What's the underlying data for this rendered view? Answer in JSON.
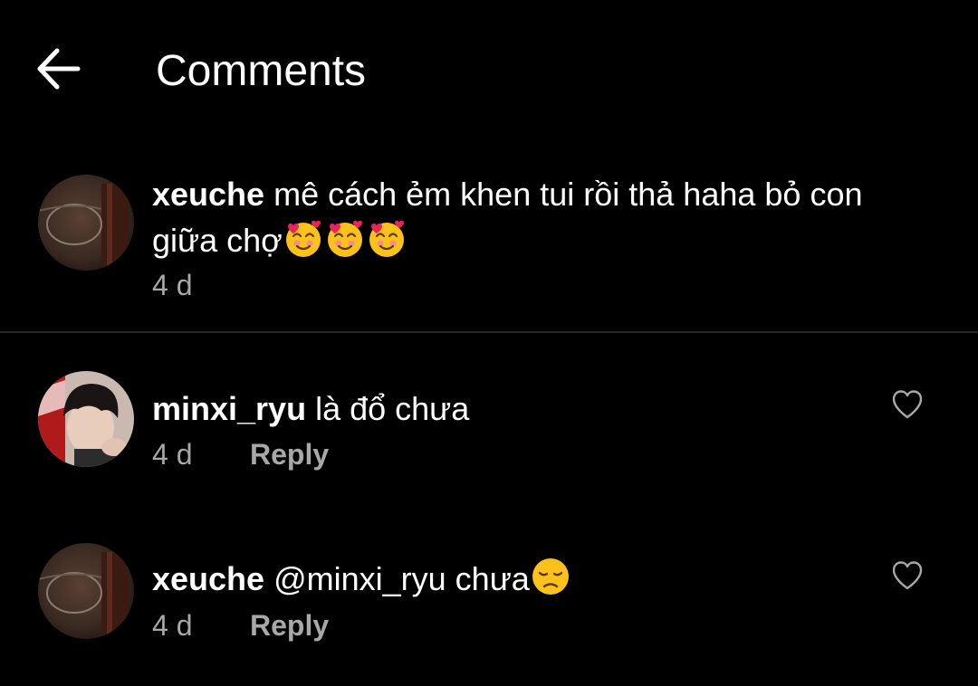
{
  "header": {
    "title": "Comments",
    "back_icon": "arrow-left-icon"
  },
  "caption": {
    "username": "xeuche",
    "text_line1": "mê cách ẻm khen tui rồi thả haha bỏ con",
    "text_line2": "giữa chợ",
    "emojis": [
      "smiling-face-with-hearts",
      "smiling-face-with-hearts",
      "smiling-face-with-hearts"
    ],
    "time": "4 d"
  },
  "comments": [
    {
      "username": "minxi_ryu",
      "text": "là đổ chưa",
      "time": "4 d",
      "reply_label": "Reply",
      "like_icon": "heart-outline-icon"
    },
    {
      "username": "xeuche",
      "text": "@minxi_ryu chưa",
      "emoji": "disappointed-face",
      "time": "4 d",
      "reply_label": "Reply",
      "like_icon": "heart-outline-icon"
    }
  ],
  "colors": {
    "background": "#000000",
    "text": "#ffffff",
    "secondary_text": "#a8a8a8",
    "divider": "#262626"
  }
}
